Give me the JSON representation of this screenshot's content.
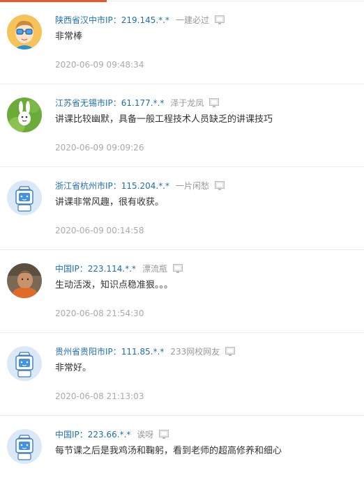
{
  "comments": [
    {
      "location": "陕西省汉中市IP：219.145.*.*",
      "nickname": "一建必过",
      "text": "非常棒",
      "time": "2020-06-09 09:48:34",
      "avatar": "cartoon-man-with-glasses"
    },
    {
      "location": "江苏省无锡市IP：61.177.*.*",
      "nickname": "泽于龙凤",
      "text": "讲课比较幽默，具备一般工程技术人员缺乏的讲课技巧",
      "time": "2020-06-09 09:09:26",
      "avatar": "green-rabbit-cartoon"
    },
    {
      "location": "浙江省杭州市IP：115.204.*.*",
      "nickname": "一片闲愁",
      "text": "讲课非常风趣，很有收获。",
      "time": "2020-06-09 00:14:58",
      "avatar": "default-robot"
    },
    {
      "location": "中国IP：223.114.*.*",
      "nickname": "漂流瓶",
      "text": "生动活泼，知识点稳准狠。。。",
      "time": "2020-06-08 21:54:30",
      "avatar": "photo-person"
    },
    {
      "location": "贵州省贵阳市IP：111.85.*.*",
      "nickname": "233网校网友",
      "text": "非常好。",
      "time": "2020-06-08 21:13:03",
      "avatar": "default-robot"
    },
    {
      "location": "中国IP：223.66.*.*",
      "nickname": "诶呀",
      "text": "每节课之后是我鸡汤和鞠躬，看到老师的超高修养和细心",
      "time": "",
      "avatar": "default-robot"
    }
  ],
  "colors": {
    "location": "#1f6fb2",
    "nickname": "#999999",
    "text": "#333333",
    "time": "#aaaaaa",
    "accent": "#e8582c"
  }
}
